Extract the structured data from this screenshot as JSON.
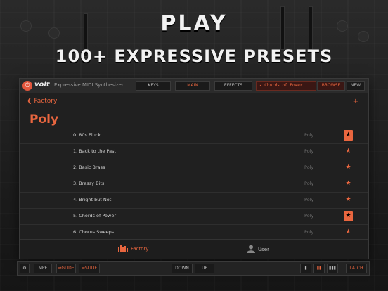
{
  "headline": {
    "line1": "PLAY",
    "line2": "100+ EXPRESSIVE PRESETS"
  },
  "topbar": {
    "logo": "volt",
    "subtitle": "Expressive MIDI Synthesizer",
    "tabs": [
      "KEYS",
      "MAIN",
      "EFFECTS"
    ],
    "active_tab": "MAIN",
    "preset_name": "Chords of Power",
    "browse_label": "BROWSE",
    "new_label": "NEW"
  },
  "nav": {
    "back_label": "Factory",
    "add_label": "+"
  },
  "page": {
    "title": "Poly"
  },
  "presets": [
    {
      "name": "0. 80s Pluck",
      "category": "Poly",
      "favorite": true
    },
    {
      "name": "1. Back to the Past",
      "category": "Poly",
      "favorite": false
    },
    {
      "name": "2. Basic Brass",
      "category": "Poly",
      "favorite": false
    },
    {
      "name": "3. Brassy Bits",
      "category": "Poly",
      "favorite": false
    },
    {
      "name": "4. Bright but Not",
      "category": "Poly",
      "favorite": false
    },
    {
      "name": "5. Chords of Power",
      "category": "Poly",
      "favorite": true
    },
    {
      "name": "6. Chorus Sweeps",
      "category": "Poly",
      "favorite": false
    }
  ],
  "tabs": {
    "factory": "Factory",
    "user": "User"
  },
  "bottombar": {
    "mpe": "MPE",
    "glide1": "GLIDE",
    "glide2": "SLIDE",
    "down": "DOWN",
    "up": "UP",
    "latch": "LATCH"
  },
  "colors": {
    "accent": "#e9663f",
    "background": "#202020"
  }
}
